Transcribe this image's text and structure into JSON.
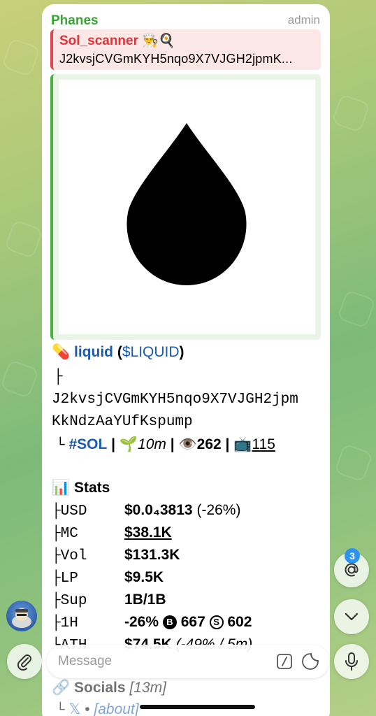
{
  "message": {
    "sender": "Phanes",
    "role": "admin",
    "reply": {
      "name": "Sol_scanner 👨‍🍳🍳",
      "text": "J2kvsjCVGmKYH5nqo9X7VJGH2jpmK..."
    },
    "token": {
      "emoji": "💊",
      "name": "liquid",
      "paren_open": "(",
      "ticker": "$LIQUID",
      "paren_close": ")",
      "tree_top": "├",
      "address_line1": "J2kvsjCVGmKYH5nqo9X7VJGH2jpm",
      "address_line2": "KkNdzAaYUfKspump",
      "tree_end": "└",
      "chain_tag": "#SOL",
      "sep": "|",
      "age_emoji": "🌱",
      "age": "10m",
      "views_emoji": "👁️",
      "views": "262",
      "tv_emoji": "📺",
      "tv_count": "115"
    },
    "stats": {
      "emoji": "📊",
      "title": "Stats",
      "rows": [
        {
          "prefix": "├",
          "label": "USD",
          "value": "$0.0₄3813",
          "extra": "(-26%)"
        },
        {
          "prefix": "├",
          "label": "MC",
          "value": "$38.1K",
          "extra": ""
        },
        {
          "prefix": "├",
          "label": "Vol",
          "value": "$131.3K",
          "extra": ""
        },
        {
          "prefix": "├",
          "label": "LP",
          "value": "$9.5K",
          "extra": ""
        },
        {
          "prefix": "├",
          "label": "Sup",
          "value": "1B/1B",
          "extra": ""
        },
        {
          "prefix": "├",
          "label": "1H",
          "value": "-26%",
          "extra": ""
        },
        {
          "prefix": "└",
          "label": "ATH",
          "value": "$74.5K",
          "extra": "(-49% / 5m)"
        }
      ],
      "h1_buys_icon": "B",
      "h1_buys": "667",
      "h1_sells_icon": "S",
      "h1_sells": "602"
    },
    "socials": {
      "emoji": "🔗",
      "title": "Socials",
      "age": "[13m]",
      "tree_end": "└",
      "x_label": "𝕏",
      "dot": "•",
      "about": "[about]"
    }
  },
  "mentions_badge": "3",
  "composer": {
    "placeholder": "Message"
  },
  "colors": {
    "sender": "#36a832",
    "reply_accent": "#e0474a",
    "preview_accent": "#46b341",
    "link": "#1b5bb1",
    "badge": "#2c93f0"
  },
  "icons": [
    "attach-icon",
    "command-icon",
    "sticker-icon",
    "mic-icon",
    "at-icon",
    "chevron-down-icon",
    "drop-icon"
  ]
}
